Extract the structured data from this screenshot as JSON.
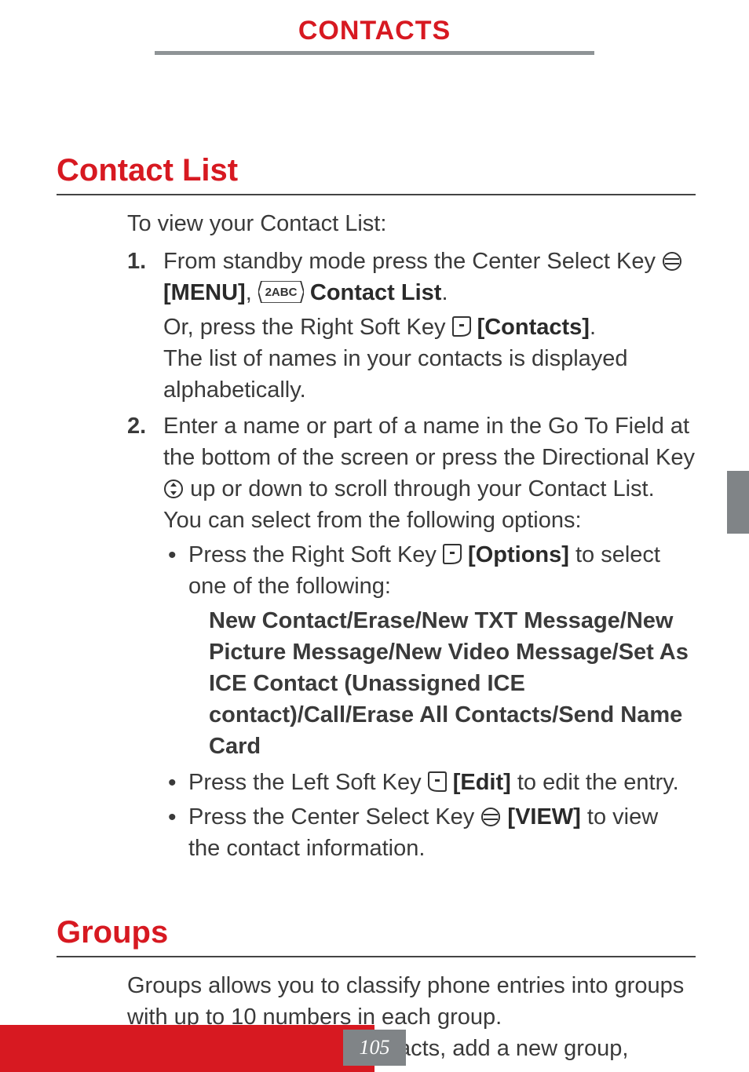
{
  "header": {
    "title": "CONTACTS"
  },
  "section_contact_list": {
    "title": "Contact List",
    "intro": "To view your Contact List:",
    "step1": {
      "num": "1.",
      "t1": "From standby mode press the Center Select Key ",
      "menu_label": "[MENU]",
      "comma": ", ",
      "key2_label": "Contact List",
      "period1": ".",
      "t2a": "Or, press the Right Soft Key ",
      "contacts_label": "[Contacts]",
      "period2": ".",
      "t3": "The list of names in your contacts is displayed alphabetically."
    },
    "step2": {
      "num": "2.",
      "t1a": "Enter a name or part of a name in the Go To Field at the bottom of the screen or press the Directional Key ",
      "t1b": " up or down to scroll through your Contact List. You can select from the following options:",
      "bullet1a": "Press the Right Soft Key ",
      "options_label": "[Options]",
      "bullet1b": " to select one of the following:",
      "options_list": "New Contact/Erase/New TXT Message/New Picture Message/New Video Message/Set As ICE Contact (Unassigned ICE contact)/Call/Erase All Contacts/Send Name Card",
      "bullet2a": "Press the Left Soft Key ",
      "edit_label": "[Edit]",
      "bullet2b": " to edit the entry.",
      "bullet3a": "Press the Center Select Key ",
      "view_label": "[VIEW]",
      "bullet3b": " to view the contact information."
    }
  },
  "section_groups": {
    "title": "Groups",
    "p1": "Groups allows you to classify phone entries into groups with up to 10 numbers in each group.",
    "p2": "To view your grouped Contacts, add a new group,"
  },
  "page_number": "105"
}
